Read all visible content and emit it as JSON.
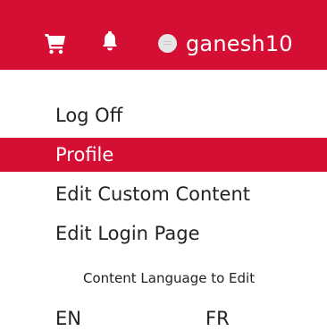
{
  "header": {
    "cart_icon": "shopping-cart-icon",
    "bell_icon": "notification-bell-icon",
    "avatar": "user-avatar",
    "username": "ganesh10",
    "bar_color": "#d50f34"
  },
  "menu": {
    "items": [
      {
        "label": "Log Off"
      },
      {
        "label": "Profile",
        "active": true
      },
      {
        "label": "Edit Custom Content"
      },
      {
        "label": "Edit Login Page"
      }
    ]
  },
  "languages": {
    "label": "Content Language to Edit",
    "options": [
      "EN",
      "FR"
    ]
  }
}
